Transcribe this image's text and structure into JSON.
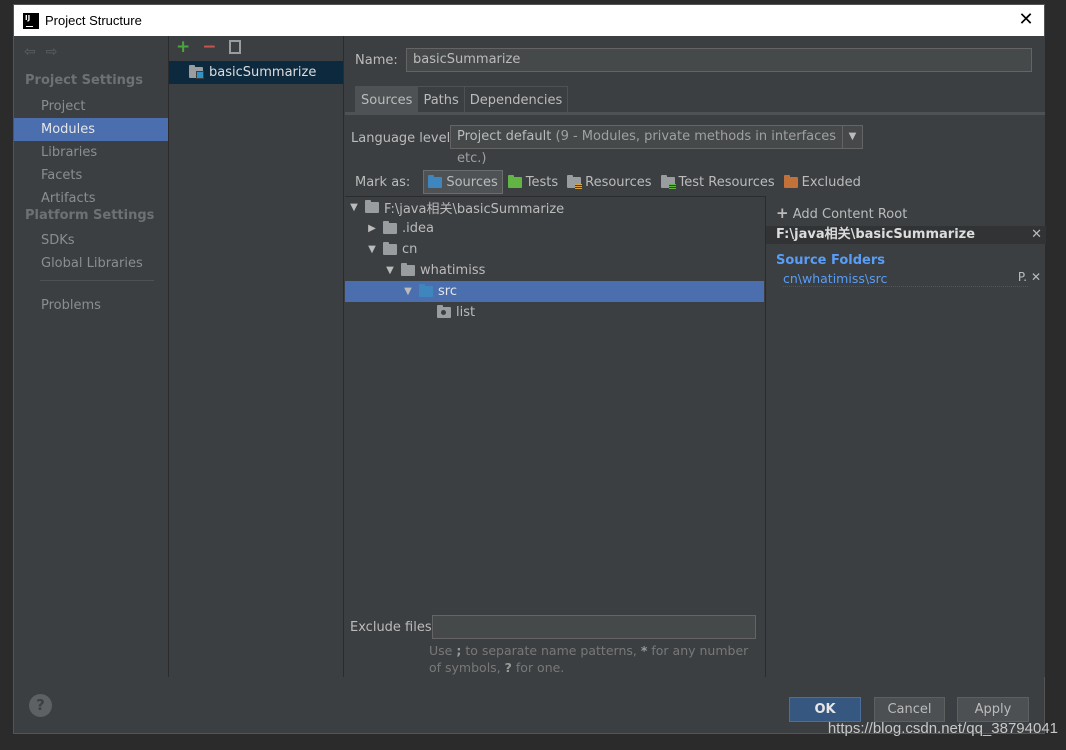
{
  "window": {
    "title": "Project Structure"
  },
  "nav": {
    "section_project": "Project Settings",
    "section_platform": "Platform Settings",
    "items": [
      {
        "label": "Project"
      },
      {
        "label": "Modules"
      },
      {
        "label": "Libraries"
      },
      {
        "label": "Facets"
      },
      {
        "label": "Artifacts"
      },
      {
        "label": "SDKs"
      },
      {
        "label": "Global Libraries"
      },
      {
        "label": "Problems"
      }
    ],
    "selected": "Modules"
  },
  "modules": {
    "items": [
      {
        "label": "basicSummarize"
      }
    ]
  },
  "module_settings": {
    "name_label": "Name:",
    "name_value": "basicSummarize",
    "tabs": [
      {
        "label": "Sources"
      },
      {
        "label": "Paths"
      },
      {
        "label": "Dependencies"
      }
    ],
    "active_tab": "Sources",
    "language_level_label": "Language level:",
    "language_level_value": "Project default",
    "language_level_detail": "(9 - Modules, private methods in interfaces etc.)",
    "mark_as_label": "Mark as:",
    "mark_as": [
      {
        "label": "Sources",
        "icon": "sources-folder-icon"
      },
      {
        "label": "Tests",
        "icon": "tests-folder-icon"
      },
      {
        "label": "Resources",
        "icon": "resources-folder-icon"
      },
      {
        "label": "Test Resources",
        "icon": "test-resources-folder-icon"
      },
      {
        "label": "Excluded",
        "icon": "excluded-folder-icon"
      }
    ],
    "tree": [
      {
        "label": "F:\\java相关\\basicSummarize",
        "expanded": true
      },
      {
        "label": ".idea",
        "expanded": false
      },
      {
        "label": "cn",
        "expanded": true
      },
      {
        "label": "whatimiss",
        "expanded": true
      },
      {
        "label": "src",
        "expanded": true,
        "selected": true
      },
      {
        "label": "list"
      }
    ],
    "exclude_label": "Exclude files:",
    "exclude_value": "",
    "exclude_hint_1": "Use",
    "exclude_hint_sep": ";",
    "exclude_hint_2": "to separate name patterns,",
    "exclude_hint_star": "*",
    "exclude_hint_3": "for any number of symbols,",
    "exclude_hint_q": "?",
    "exclude_hint_4": "for one."
  },
  "content_root": {
    "add_label": "Add Content Root",
    "root_path": "F:\\java相关\\basicSummarize",
    "source_folders_title": "Source Folders",
    "source_folders": [
      "cn\\whatimiss\\src"
    ],
    "item_tools": "P."
  },
  "buttons": {
    "ok": "OK",
    "cancel": "Cancel",
    "apply": "Apply",
    "help": "?"
  },
  "watermark": "https://blog.csdn.net/qq_38794041",
  "colors": {
    "selection": "#4b6eaf",
    "source_blue": "#589df6",
    "ok_button": "#365880"
  }
}
